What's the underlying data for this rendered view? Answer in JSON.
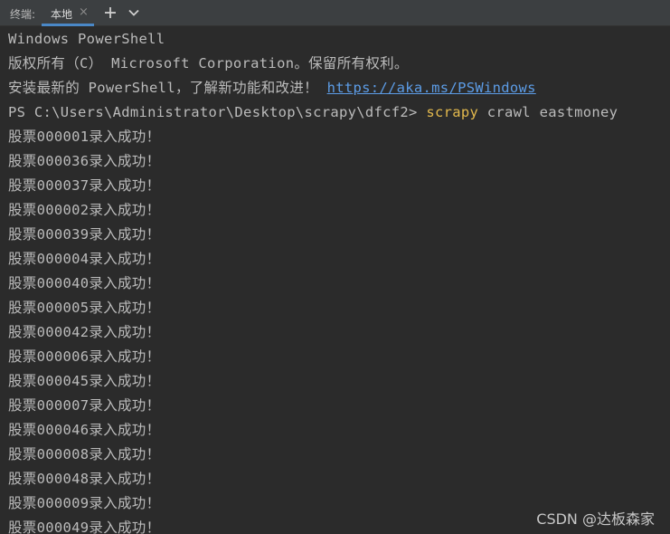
{
  "tabbar": {
    "label": "终端:",
    "tab_label": "本地",
    "close_glyph": "×",
    "add_icon": "plus-icon",
    "menu_icon": "chevron-down-icon"
  },
  "terminal": {
    "header_lines": [
      "Windows PowerShell",
      "版权所有（C） Microsoft Corporation。保留所有权利。"
    ],
    "install_prefix": "安装最新的 PowerShell，了解新功能和改进！",
    "install_link": "https://aka.ms/PSWindows",
    "prompt": "PS C:\\Users\\Administrator\\Desktop\\scrapy\\dfcf2>",
    "command": "scrapy",
    "command_args": "crawl eastmoney",
    "output_lines": [
      "股票000001录入成功！",
      "股票000036录入成功！",
      "股票000037录入成功！",
      "股票000002录入成功！",
      "股票000039录入成功！",
      "股票000004录入成功！",
      "股票000040录入成功！",
      "股票000005录入成功！",
      "股票000042录入成功！",
      "股票000006录入成功！",
      "股票000045录入成功！",
      "股票000007录入成功！",
      "股票000046录入成功！",
      "股票000008录入成功！",
      "股票000048录入成功！",
      "股票000009录入成功！",
      "股票000049录入成功！"
    ]
  },
  "watermark": "CSDN @达板森家",
  "colors": {
    "background": "#2b2b2b",
    "text": "#bbbbbb",
    "link": "#5c9ce6",
    "command": "#e3b94d",
    "tab_accent": "#4a88c7"
  }
}
